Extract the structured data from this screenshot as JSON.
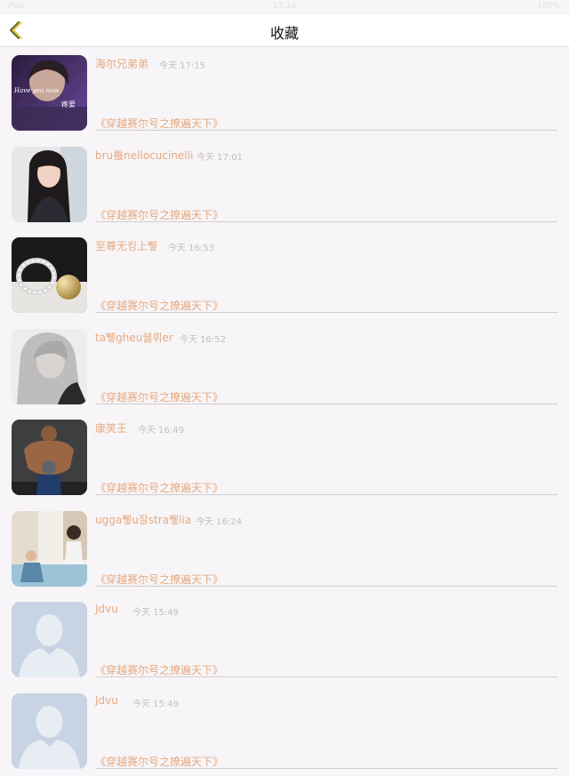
{
  "status": {
    "left": "iPad",
    "time": "17:18",
    "right": "100%"
  },
  "nav": {
    "title": "收藏"
  },
  "colors": {
    "accent": "#e6a97f",
    "back_arrow": "#6b6a1e",
    "time_text": "#c1bfc2"
  },
  "items": [
    {
      "name": "海尔兄弟弟",
      "time": "今天 17:15",
      "book": "《穿越赛尔号之撩遍天下》",
      "avatar": "photo-girl-purple"
    },
    {
      "name": "bru蚕nellocucinelli",
      "time": "今天 17:01",
      "book": "《穿越赛尔号之撩遍天下》",
      "avatar": "photo-girl-dark-hair"
    },
    {
      "name": "至尊无킹上쀟",
      "time": "今天 16:53",
      "book": "《穿越赛尔号之撩遍天下》",
      "avatar": "photo-jewelry"
    },
    {
      "name": "ta쀟gheu쉞뤼er",
      "time": "今天 16:52",
      "book": "《穿越赛尔号之撩遍天下》",
      "avatar": "photo-blonde-bw"
    },
    {
      "name": "康笑王",
      "time": "今天 16:49",
      "book": "《穿越赛尔号之撩遍天下》",
      "avatar": "photo-bodybuilder"
    },
    {
      "name": "ugga쀟u잘stra쀟lia",
      "time": "今天 16:24",
      "book": "《穿越赛尔号之撩遍天下》",
      "avatar": "photo-couple"
    },
    {
      "name": "Jdvu",
      "time": "今天 15:49",
      "book": "《穿越赛尔号之撩遍天下》",
      "avatar": "default-avatar"
    },
    {
      "name": "Jdvu",
      "time": "今天 15:49",
      "book": "《穿越赛尔号之撩遍天下》",
      "avatar": "default-avatar"
    }
  ]
}
